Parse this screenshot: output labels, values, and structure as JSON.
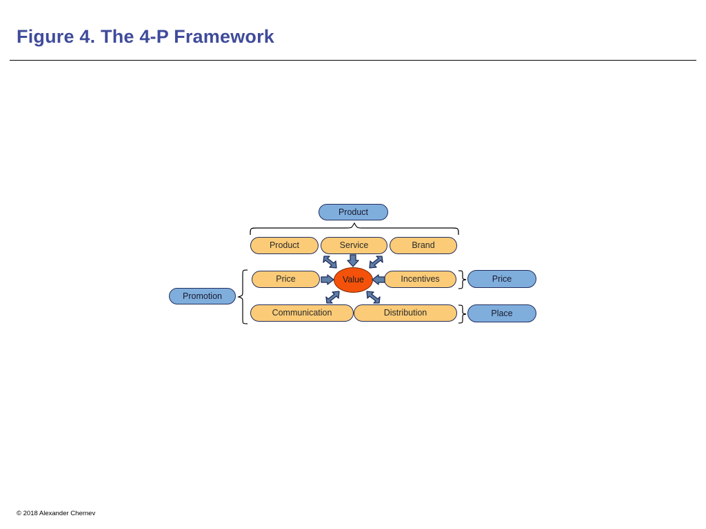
{
  "header": {
    "title": "Figure 4. The 4-P Framework"
  },
  "footer": {
    "copyright": "© 2018 Alexander Chernev"
  },
  "colors": {
    "title": "#3F4B9A",
    "blue_node": "#7FAEDD",
    "amber_node": "#FBCB77",
    "value_oval": "#F4520A",
    "node_border": "#1F2B5B",
    "arrow_fill": "#5E7FA6",
    "arrow_stroke": "#1F2B5B",
    "rule": "#000000"
  },
  "diagram": {
    "name": "4-p-framework-diagram",
    "top_label": {
      "text": "Product",
      "style": "blue"
    },
    "left_label": {
      "text": "Promotion",
      "style": "blue"
    },
    "right_labels": [
      {
        "text": "Price",
        "style": "blue"
      },
      {
        "text": "Place",
        "style": "blue"
      }
    ],
    "attribute_rows": [
      {
        "name": "product-row",
        "cells": [
          {
            "text": "Product",
            "style": "amber"
          },
          {
            "text": "Service",
            "style": "amber"
          },
          {
            "text": "Brand",
            "style": "amber"
          }
        ]
      },
      {
        "name": "value-row",
        "cells": [
          {
            "text": "Price",
            "style": "amber"
          },
          {
            "text": "Value",
            "style": "oval"
          },
          {
            "text": "Incentives",
            "style": "amber"
          }
        ]
      },
      {
        "name": "delivery-row",
        "cells": [
          {
            "text": "Communication",
            "style": "amber"
          },
          {
            "text": "Distribution",
            "style": "amber"
          }
        ]
      }
    ],
    "center_node": {
      "text": "Value",
      "style": "oval"
    },
    "arrows": [
      {
        "name": "arrow-from-product",
        "direction": "down-right"
      },
      {
        "name": "arrow-from-service",
        "direction": "down"
      },
      {
        "name": "arrow-from-brand",
        "direction": "down-left"
      },
      {
        "name": "arrow-from-price",
        "direction": "right"
      },
      {
        "name": "arrow-from-incentives",
        "direction": "left"
      },
      {
        "name": "arrow-from-communication",
        "direction": "up-right"
      },
      {
        "name": "arrow-from-distribution",
        "direction": "up-left"
      }
    ],
    "braces": [
      {
        "name": "brace-top-product",
        "orientation": "horizontal-down"
      },
      {
        "name": "brace-left-promotion",
        "orientation": "vertical-left"
      },
      {
        "name": "brace-right-price",
        "orientation": "vertical-right"
      },
      {
        "name": "brace-right-place",
        "orientation": "vertical-right"
      }
    ]
  }
}
